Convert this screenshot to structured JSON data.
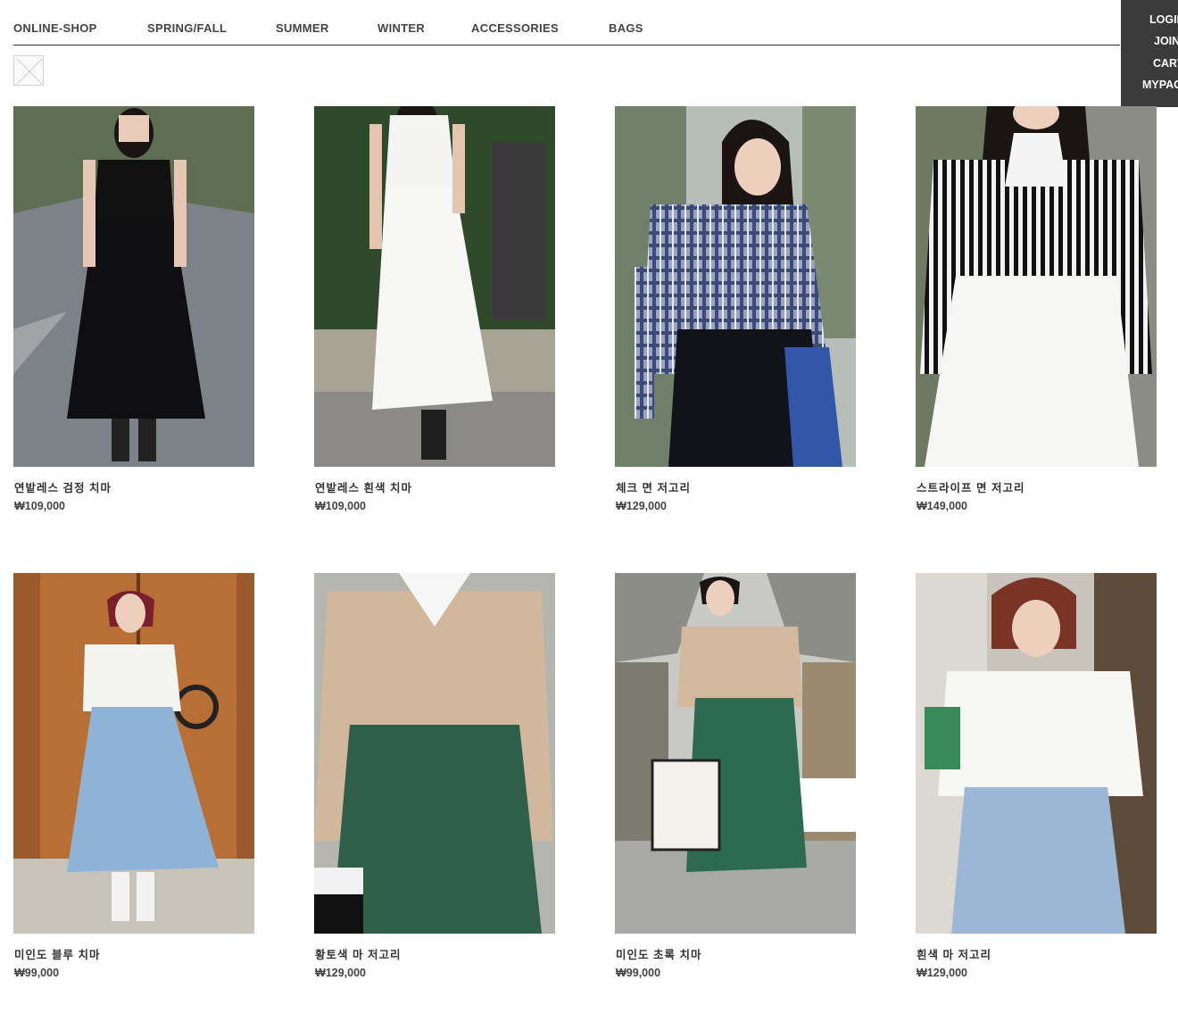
{
  "nav": {
    "items": [
      "ONLINE-SHOP",
      "SPRING/FALL",
      "SUMMER",
      "WINTER",
      "ACCESSORIES",
      "BAGS"
    ]
  },
  "user_menu": {
    "items": [
      "LOGIN",
      "JOIN",
      "CART",
      "MYPAGE"
    ]
  },
  "products": [
    {
      "name": "연밭레스 검정 치마",
      "price": "₩109,000"
    },
    {
      "name": "연밭레스 흰색 치마",
      "price": "₩109,000"
    },
    {
      "name": "체크 면 저고리",
      "price": "₩129,000"
    },
    {
      "name": "스트라이프 면 저고리",
      "price": "₩149,000"
    },
    {
      "name": "미인도 블루 치마",
      "price": "₩99,000"
    },
    {
      "name": "황토색 마 저고리",
      "price": "₩129,000"
    },
    {
      "name": "미인도 초록 치마",
      "price": "₩99,000"
    },
    {
      "name": "흰색 마 저고리",
      "price": "₩129,000"
    }
  ],
  "colors": {
    "nav_text": "#444444",
    "panel_bg": "#3b3b3b",
    "divider": "#333333"
  }
}
